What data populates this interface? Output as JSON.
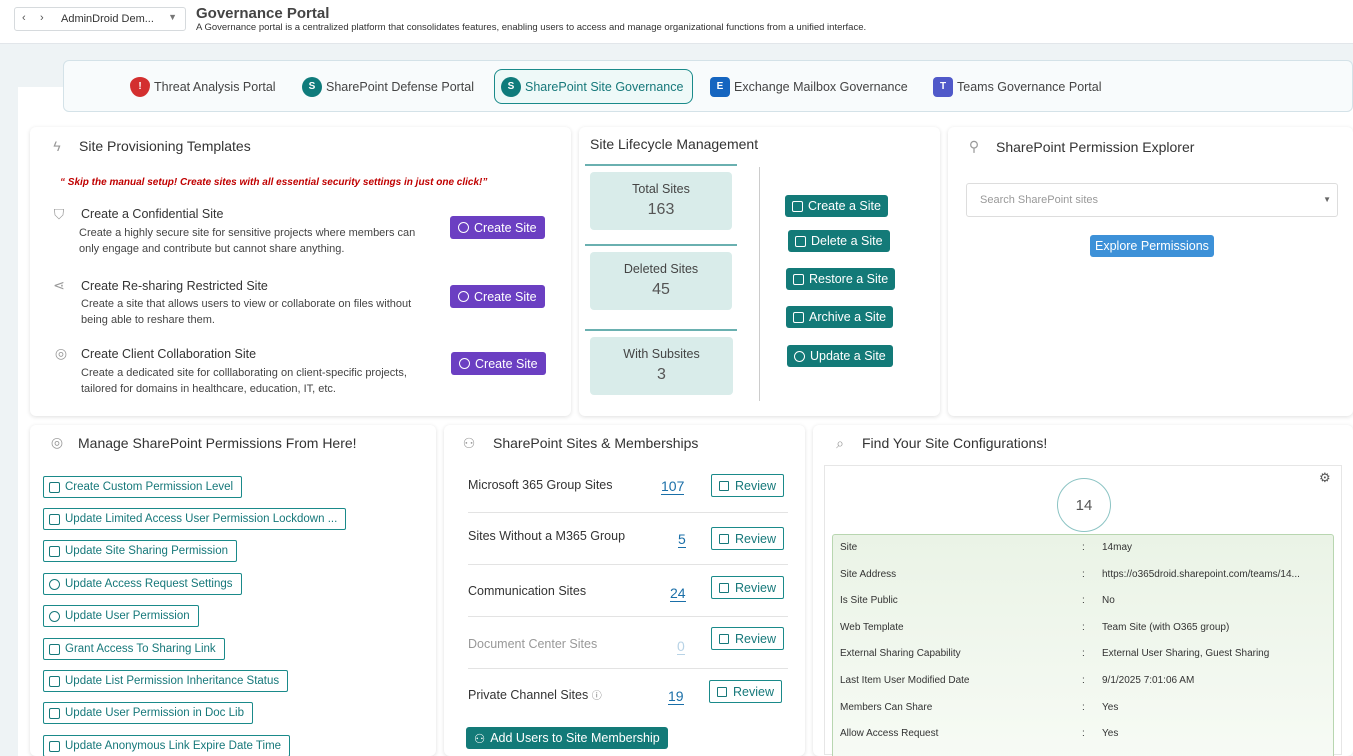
{
  "header": {
    "nav_back": "‹",
    "nav_forward": "›",
    "tenant_select": "AdminDroid Dem...",
    "title": "Governance Portal",
    "subtitle": "A Governance portal is a centralized platform that consolidates features, enabling users to access and manage organizational functions from a unified interface."
  },
  "tabs": [
    {
      "label": "Threat Analysis Portal",
      "icon": "shield-alert-icon",
      "color": "#d32f2f"
    },
    {
      "label": "SharePoint Defense Portal",
      "icon": "sharepoint-icon",
      "color": "#0f7b7b"
    },
    {
      "label": "SharePoint Site Governance",
      "icon": "sharepoint-icon",
      "color": "#0f7b7b"
    },
    {
      "label": "Exchange Mailbox Governance",
      "icon": "exchange-icon",
      "color": "#1565c0"
    },
    {
      "label": "Teams Governance Portal",
      "icon": "teams-icon",
      "color": "#5059c9"
    }
  ],
  "provisioning": {
    "title": "Site Provisioning Templates",
    "note": "“ Skip the manual setup! Create sites with all essential security settings in just one click!”",
    "items": [
      {
        "title": "Create a Confidential Site",
        "desc": "Create a highly secure site for sensitive projects where members can only engage and contribute but cannot share anything.",
        "button": "Create Site"
      },
      {
        "title": "Create Re-sharing Restricted Site",
        "desc": "Create a site that allows users to view or collaborate on files without being able to reshare them.",
        "button": "Create Site"
      },
      {
        "title": "Create Client Collaboration Site",
        "desc": "Create a dedicated site for colllaborating on client-specific projects, tailored for domains in healthcare, education, IT, etc.",
        "button": "Create Site"
      }
    ]
  },
  "lifecycle": {
    "title": "Site Lifecycle Management",
    "stats": [
      {
        "label": "Total Sites",
        "value": "163"
      },
      {
        "label": "Deleted Sites",
        "value": "45"
      },
      {
        "label": "With Subsites",
        "value": "3"
      }
    ],
    "actions": [
      "Create a Site",
      "Delete a Site",
      "Restore a Site",
      "Archive a Site",
      "Update a Site"
    ]
  },
  "explorer": {
    "title": "SharePoint Permission Explorer",
    "search_placeholder": "Search SharePoint sites",
    "button": "Explore Permissions"
  },
  "permissions": {
    "title": "Manage SharePoint Permissions From Here!",
    "actions": [
      "Create Custom Permission Level",
      "Update Limited Access User Permission Lockdown ...",
      "Update Site Sharing Permission",
      "Update Access Request Settings",
      "Update User Permission",
      "Grant Access To Sharing Link",
      "Update List Permission Inheritance Status",
      "Update User Permission in Doc Lib",
      "Update Anonymous Link Expire Date Time"
    ]
  },
  "memberships": {
    "title": "SharePoint Sites & Memberships",
    "rows": [
      {
        "label": "Microsoft 365 Group Sites",
        "value": "107",
        "button": "Review"
      },
      {
        "label": "Sites Without a M365 Group",
        "value": "5",
        "button": "Review"
      },
      {
        "label": "Communication Sites",
        "value": "24",
        "button": "Review"
      },
      {
        "label": "Document Center Sites",
        "value": "0",
        "button": "Review"
      },
      {
        "label": "Private Channel Sites",
        "value": "19",
        "button": "Review"
      }
    ],
    "info_icon": "ⓘ",
    "add_button": "Add Users to Site Membership"
  },
  "config": {
    "title": "Find Your Site Configurations!",
    "count": "14",
    "separator": ":",
    "rows": [
      {
        "key": "Site",
        "value": "14may"
      },
      {
        "key": "Site Address",
        "value": "https://o365droid.sharepoint.com/teams/14..."
      },
      {
        "key": "Is Site Public",
        "value": "No"
      },
      {
        "key": "Web Template",
        "value": "Team Site (with O365 group)"
      },
      {
        "key": "External Sharing Capability",
        "value": "External User Sharing, Guest Sharing"
      },
      {
        "key": "Last Item User Modified Date",
        "value": "9/1/2025 7:01:06 AM"
      },
      {
        "key": "Members Can Share",
        "value": "Yes"
      },
      {
        "key": "Allow Access Request",
        "value": "Yes"
      }
    ]
  }
}
